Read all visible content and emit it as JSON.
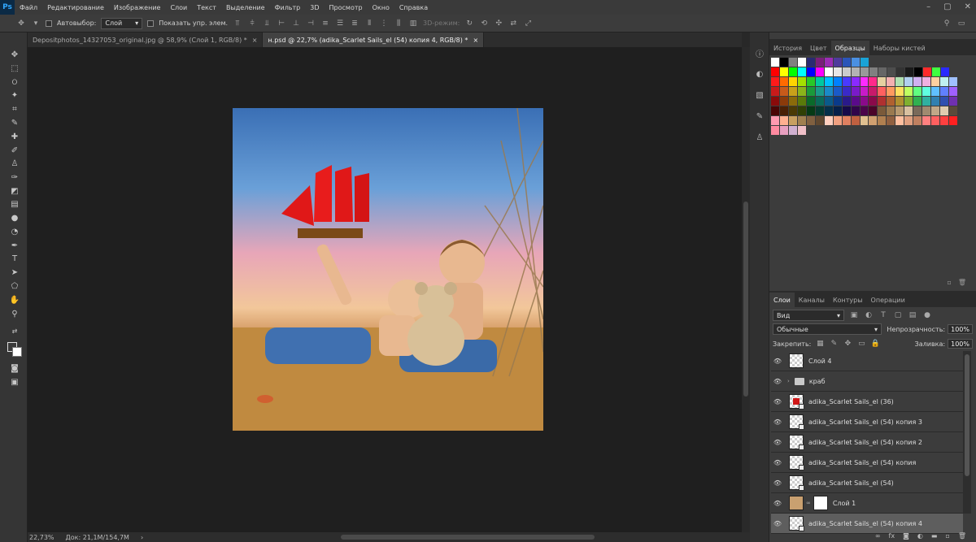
{
  "app_logo": "Ps",
  "menu": [
    "Файл",
    "Редактирование",
    "Изображение",
    "Слои",
    "Текст",
    "Выделение",
    "Фильтр",
    "3D",
    "Просмотр",
    "Окно",
    "Справка"
  ],
  "options": {
    "autoselect_label": "Автовыбор:",
    "autoselect_value": "Слой",
    "show_controls_label": "Показать упр. элем.",
    "mode3d_label": "3D-режим:"
  },
  "tabs": [
    {
      "label": "Depositphotos_14327053_original.jpg @ 58,9% (Слой 1, RGB/8) *",
      "close": "×"
    },
    {
      "label": "н.psd @ 22,7% (adika_Scarlet Sails_el (54) копия 4, RGB/8) *",
      "close": "×"
    }
  ],
  "status": {
    "zoom": "22,73%",
    "doc": "Док: 21,1M/154,7M",
    "arrow": "›"
  },
  "panel_top": {
    "tabs": [
      "История",
      "Цвет",
      "Образцы",
      "Наборы кистей"
    ],
    "active_tab": "Образцы"
  },
  "swatch_rows": [
    [
      "#ffffff",
      "#000000",
      "#808080",
      "#ffffff",
      "#2a2a72",
      "#7a1f7a",
      "#9b2db5",
      "#4f3a9c",
      "#2b55b8",
      "#4a90e2",
      "#1aa3d6"
    ],
    [
      "#ff0000",
      "#ffff00",
      "#00ff00",
      "#00ffff",
      "#0000ff",
      "#ff00ff",
      "#ffffff",
      "#e6e6e6",
      "#cccccc",
      "#b3b3b3",
      "#999999",
      "#808080",
      "#666666",
      "#4d4d4d",
      "#333333",
      "#1a1a1a",
      "#000000",
      "#ff2a2a",
      "#40ff40",
      "#2a2aff"
    ],
    [
      "#ff1a1a",
      "#ff6a00",
      "#ffd400",
      "#a4e000",
      "#28c828",
      "#00c8a0",
      "#00c0ff",
      "#0080ff",
      "#4a3aff",
      "#8a2aff",
      "#ff2aff",
      "#ff2a8a",
      "#e6d0a0",
      "#f4b0b0",
      "#b0e0b0",
      "#b0d0f0",
      "#d0b0f0",
      "#f0b0e0",
      "#ffd0a0",
      "#c0f0f0",
      "#a0c0ff"
    ],
    [
      "#c81a1a",
      "#c85a1a",
      "#c8a01a",
      "#8ab41a",
      "#1a9a3a",
      "#1a9a8a",
      "#1a8ac8",
      "#1a5ac8",
      "#3a2ac8",
      "#7a1ac8",
      "#c81ac8",
      "#c81a6a",
      "#ff6060",
      "#ff9a60",
      "#ffe060",
      "#c0ff60",
      "#60ff80",
      "#60ffe0",
      "#60c0ff",
      "#6080ff",
      "#a060ff"
    ],
    [
      "#8a0a0a",
      "#8a3a0a",
      "#8a6a0a",
      "#5a7a0a",
      "#0a6a2a",
      "#0a6a5a",
      "#0a5a8a",
      "#0a3a8a",
      "#2a1a8a",
      "#5a0a8a",
      "#8a0a8a",
      "#8a0a4a",
      "#b03030",
      "#b06030",
      "#b09030",
      "#80b030",
      "#30b050",
      "#30b0a0",
      "#3080b0",
      "#3050b0",
      "#7030b0"
    ],
    [
      "#4a0505",
      "#4a2005",
      "#4a3a05",
      "#304005",
      "#053a15",
      "#053a30",
      "#05304a",
      "#05204a",
      "#150a4a",
      "#30054a",
      "#4a054a",
      "#4a0528",
      "#7a5a3a",
      "#9a7a50",
      "#b89a70",
      "#d8c0a0",
      "#7a6a5a",
      "#a08a70",
      "#c0a888",
      "#e0ccb0",
      "#5a4a3a"
    ],
    [
      "#ff9ab0",
      "#ffb090",
      "#c8a060",
      "#a08050",
      "#806040",
      "#604830",
      "#ffd0c0",
      "#f0a080",
      "#e08060",
      "#c06040",
      "#e0c090",
      "#d0a070",
      "#b08050",
      "#906040",
      "#ffc0a0",
      "#e0a080",
      "#c08060",
      "#ff8080",
      "#ff6060",
      "#ff4040",
      "#ff2020"
    ],
    [
      "#ff8aa0",
      "#e8a0c0",
      "#d0b0d0",
      "#f0c0c8"
    ]
  ],
  "panel_layers": {
    "tabs": [
      "Слои",
      "Каналы",
      "Контуры",
      "Операции"
    ],
    "active_tab": "Слои",
    "filter": "Вид",
    "blend": "Обычные",
    "opacity_label": "Непрозрачность:",
    "opacity": "100%",
    "lock_label": "Закрепить:",
    "fill_label": "Заливка:",
    "fill": "100%"
  },
  "layers": [
    {
      "name": "Слой 4",
      "kind": "normal"
    },
    {
      "name": "краб",
      "kind": "group"
    },
    {
      "name": "adika_Scarlet Sails_el (36)",
      "kind": "smart-ship"
    },
    {
      "name": "adika_Scarlet Sails_el (54) копия 3",
      "kind": "smart"
    },
    {
      "name": "adika_Scarlet Sails_el (54) копия 2",
      "kind": "smart"
    },
    {
      "name": "adika_Scarlet Sails_el (54) копия",
      "kind": "smart"
    },
    {
      "name": "adika_Scarlet Sails_el (54)",
      "kind": "smart"
    },
    {
      "name": "Слой 1",
      "kind": "masked"
    },
    {
      "name": "adika_Scarlet Sails_el (54) копия 4",
      "kind": "smart",
      "selected": true
    }
  ],
  "selected_layer": "adika_Scarlet Sails_el (54) копия 4"
}
